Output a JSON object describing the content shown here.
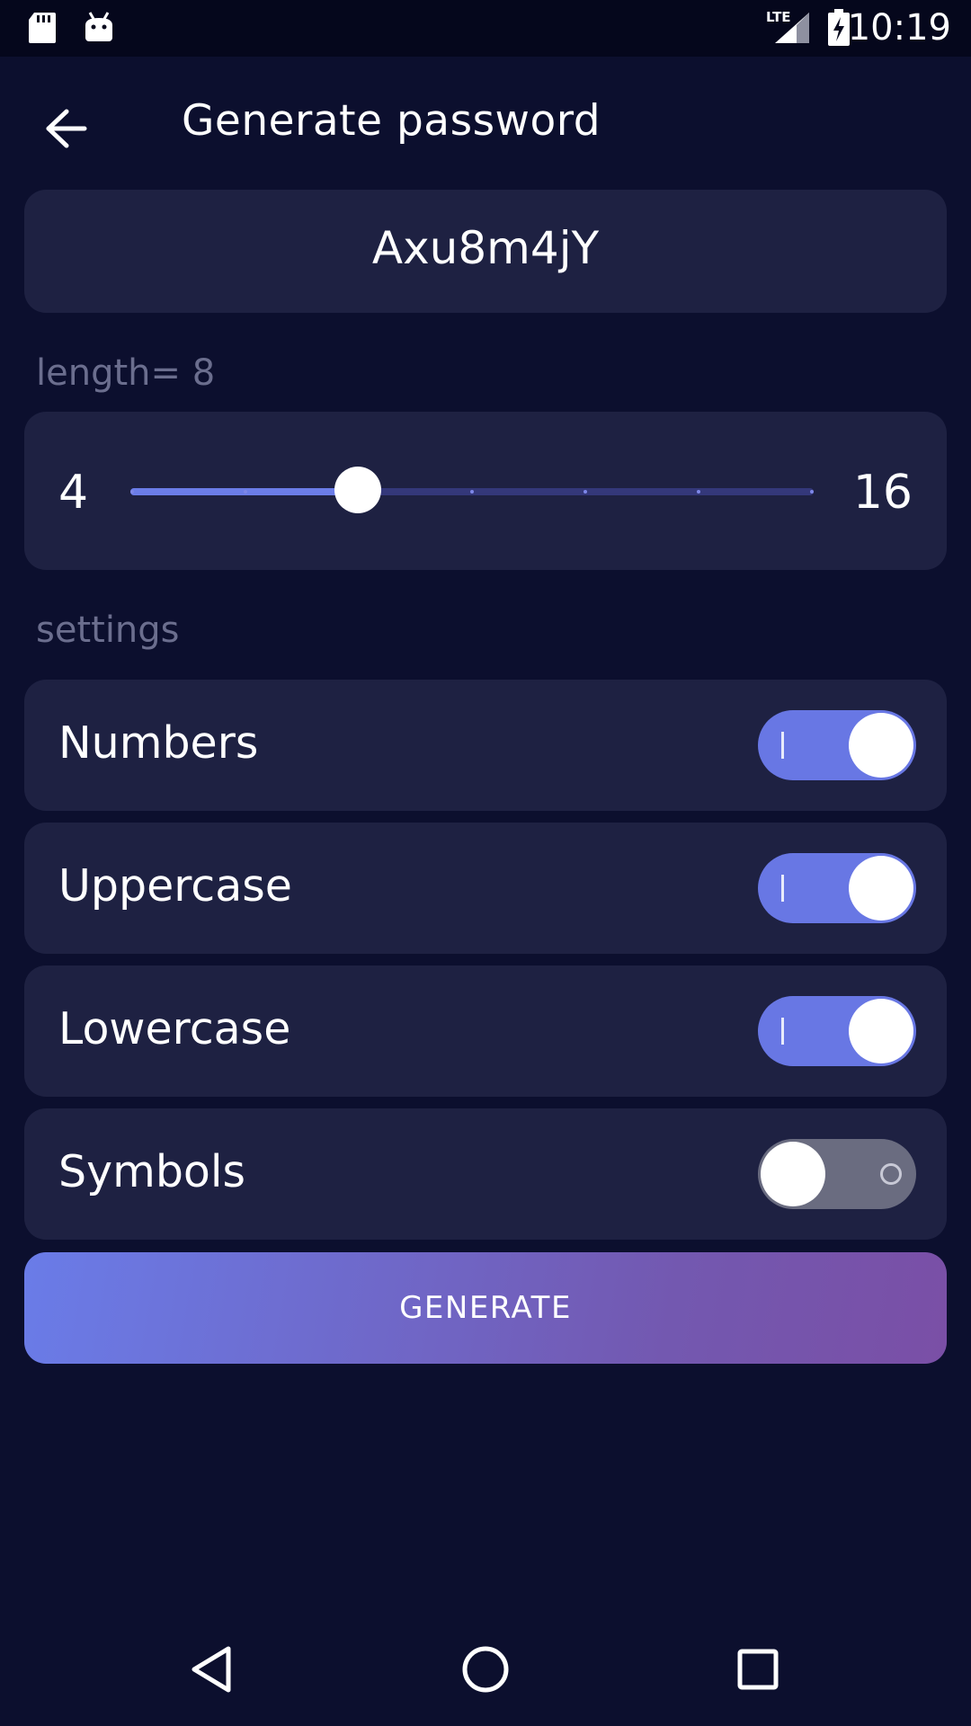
{
  "status_bar": {
    "time": "10:19",
    "network": "LTE",
    "left_icons": [
      "sd-card-icon",
      "android-debug-icon"
    ],
    "right_icons": [
      "signal-icon",
      "battery-charging-icon"
    ]
  },
  "app_bar": {
    "back_icon": "arrow-left-icon",
    "title": "Generate password"
  },
  "password": {
    "value": "Axu8m4jY"
  },
  "length": {
    "label": "length= 8",
    "min": "4",
    "max": "16",
    "value": 8,
    "min_value": 4,
    "max_value": 16,
    "step": 2
  },
  "settings": {
    "label": "settings",
    "items": [
      {
        "label": "Numbers",
        "enabled": true
      },
      {
        "label": "Uppercase",
        "enabled": true
      },
      {
        "label": "Lowercase",
        "enabled": true
      },
      {
        "label": "Symbols",
        "enabled": false
      }
    ]
  },
  "generate_button": {
    "label": "GENERATE"
  },
  "colors": {
    "background": "#0c0f2e",
    "card": "#1e2142",
    "accent": "#6877e4",
    "gradient_end": "#7a4fa6",
    "muted_text": "#6b6e8e"
  },
  "nav_bar": {
    "icons": [
      "back-triangle-icon",
      "home-circle-icon",
      "recents-square-icon"
    ]
  }
}
